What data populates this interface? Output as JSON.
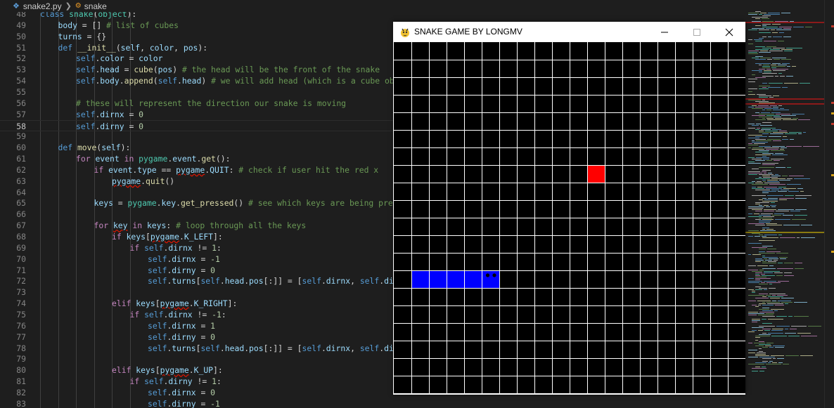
{
  "breadcrumb": {
    "file": "snake2.py",
    "symbol": "snake"
  },
  "editor": {
    "current_line": 58,
    "lines": [
      {
        "n": 48,
        "indent": 0,
        "tokens": [
          {
            "t": "class ",
            "c": "kw"
          },
          {
            "t": "snake",
            "c": "cls"
          },
          {
            "t": "(",
            "c": "txt"
          },
          {
            "t": "object",
            "c": "cls"
          },
          {
            "t": "):",
            "c": "txt"
          }
        ]
      },
      {
        "n": 49,
        "indent": 1,
        "tokens": [
          {
            "t": "body",
            "c": "var"
          },
          {
            "t": " = [] ",
            "c": "txt"
          },
          {
            "t": "# list of cubes",
            "c": "com"
          }
        ]
      },
      {
        "n": 50,
        "indent": 1,
        "tokens": [
          {
            "t": "turns",
            "c": "var"
          },
          {
            "t": " = {}",
            "c": "txt"
          }
        ]
      },
      {
        "n": 51,
        "indent": 1,
        "tokens": [
          {
            "t": "def ",
            "c": "kw"
          },
          {
            "t": "__init__",
            "c": "fn"
          },
          {
            "t": "(",
            "c": "txt"
          },
          {
            "t": "self",
            "c": "var"
          },
          {
            "t": ", ",
            "c": "txt"
          },
          {
            "t": "color",
            "c": "var"
          },
          {
            "t": ", ",
            "c": "txt"
          },
          {
            "t": "pos",
            "c": "var"
          },
          {
            "t": "):",
            "c": "txt"
          }
        ]
      },
      {
        "n": 52,
        "indent": 2,
        "tokens": [
          {
            "t": "self",
            "c": "self"
          },
          {
            "t": ".",
            "c": "txt"
          },
          {
            "t": "color",
            "c": "var"
          },
          {
            "t": " = ",
            "c": "txt"
          },
          {
            "t": "color",
            "c": "var"
          }
        ]
      },
      {
        "n": 53,
        "indent": 2,
        "tokens": [
          {
            "t": "self",
            "c": "self"
          },
          {
            "t": ".",
            "c": "txt"
          },
          {
            "t": "head",
            "c": "var"
          },
          {
            "t": " = ",
            "c": "txt"
          },
          {
            "t": "cube",
            "c": "fn"
          },
          {
            "t": "(",
            "c": "txt"
          },
          {
            "t": "pos",
            "c": "var"
          },
          {
            "t": ") ",
            "c": "txt"
          },
          {
            "t": "# the head will be the front of the snake",
            "c": "com"
          }
        ]
      },
      {
        "n": 54,
        "indent": 2,
        "tokens": [
          {
            "t": "self",
            "c": "self"
          },
          {
            "t": ".",
            "c": "txt"
          },
          {
            "t": "body",
            "c": "var"
          },
          {
            "t": ".",
            "c": "txt"
          },
          {
            "t": "append",
            "c": "fn"
          },
          {
            "t": "(",
            "c": "txt"
          },
          {
            "t": "self",
            "c": "self"
          },
          {
            "t": ".",
            "c": "txt"
          },
          {
            "t": "head",
            "c": "var"
          },
          {
            "t": ") ",
            "c": "txt"
          },
          {
            "t": "# we will add head (which is a cube object",
            "c": "com"
          }
        ]
      },
      {
        "n": 55,
        "indent": 2,
        "tokens": []
      },
      {
        "n": 56,
        "indent": 2,
        "tokens": [
          {
            "t": "# these will represent the direction our snake is moving",
            "c": "com"
          }
        ]
      },
      {
        "n": 57,
        "indent": 2,
        "tokens": [
          {
            "t": "self",
            "c": "self"
          },
          {
            "t": ".",
            "c": "txt"
          },
          {
            "t": "dirnx",
            "c": "var"
          },
          {
            "t": " = ",
            "c": "txt"
          },
          {
            "t": "0",
            "c": "num"
          }
        ]
      },
      {
        "n": 58,
        "indent": 2,
        "tokens": [
          {
            "t": "self",
            "c": "self"
          },
          {
            "t": ".",
            "c": "txt"
          },
          {
            "t": "dirny",
            "c": "var"
          },
          {
            "t": " = ",
            "c": "txt"
          },
          {
            "t": "0",
            "c": "num"
          }
        ]
      },
      {
        "n": 59,
        "indent": 1,
        "tokens": []
      },
      {
        "n": 60,
        "indent": 1,
        "tokens": [
          {
            "t": "def ",
            "c": "kw"
          },
          {
            "t": "move",
            "c": "fn"
          },
          {
            "t": "(",
            "c": "txt"
          },
          {
            "t": "self",
            "c": "var"
          },
          {
            "t": "):",
            "c": "txt"
          }
        ]
      },
      {
        "n": 61,
        "indent": 2,
        "tokens": [
          {
            "t": "for ",
            "c": "ctl"
          },
          {
            "t": "event",
            "c": "var"
          },
          {
            "t": " in ",
            "c": "ctl"
          },
          {
            "t": "pygame",
            "c": "cls"
          },
          {
            "t": ".",
            "c": "txt"
          },
          {
            "t": "event",
            "c": "var"
          },
          {
            "t": ".",
            "c": "txt"
          },
          {
            "t": "get",
            "c": "fn"
          },
          {
            "t": "():",
            "c": "txt"
          }
        ]
      },
      {
        "n": 62,
        "indent": 3,
        "tokens": [
          {
            "t": "if ",
            "c": "ctl"
          },
          {
            "t": "event",
            "c": "var"
          },
          {
            "t": ".",
            "c": "txt"
          },
          {
            "t": "type",
            "c": "var"
          },
          {
            "t": " == ",
            "c": "txt"
          },
          {
            "t": "pygame",
            "c": "err"
          },
          {
            "t": ".",
            "c": "txt"
          },
          {
            "t": "QUIT",
            "c": "var"
          },
          {
            "t": ": ",
            "c": "txt"
          },
          {
            "t": "# check if user hit the red x",
            "c": "com"
          }
        ]
      },
      {
        "n": 63,
        "indent": 4,
        "tokens": [
          {
            "t": "pygame",
            "c": "err"
          },
          {
            "t": ".",
            "c": "txt"
          },
          {
            "t": "quit",
            "c": "fn"
          },
          {
            "t": "()",
            "c": "txt"
          }
        ]
      },
      {
        "n": 64,
        "indent": 2,
        "tokens": []
      },
      {
        "n": 65,
        "indent": 3,
        "tokens": [
          {
            "t": "keys",
            "c": "var"
          },
          {
            "t": " = ",
            "c": "txt"
          },
          {
            "t": "pygame",
            "c": "cls"
          },
          {
            "t": ".",
            "c": "txt"
          },
          {
            "t": "key",
            "c": "var"
          },
          {
            "t": ".",
            "c": "txt"
          },
          {
            "t": "get_pressed",
            "c": "fn"
          },
          {
            "t": "() ",
            "c": "txt"
          },
          {
            "t": "# see which keys are being pressed",
            "c": "com"
          }
        ]
      },
      {
        "n": 66,
        "indent": 2,
        "tokens": []
      },
      {
        "n": 67,
        "indent": 3,
        "tokens": [
          {
            "t": "for ",
            "c": "ctl"
          },
          {
            "t": "key",
            "c": "err"
          },
          {
            "t": " in ",
            "c": "ctl"
          },
          {
            "t": "keys",
            "c": "var"
          },
          {
            "t": ": ",
            "c": "txt"
          },
          {
            "t": "# loop through all the keys",
            "c": "com"
          }
        ]
      },
      {
        "n": 68,
        "indent": 4,
        "tokens": [
          {
            "t": "if ",
            "c": "ctl"
          },
          {
            "t": "keys",
            "c": "var"
          },
          {
            "t": "[",
            "c": "txt"
          },
          {
            "t": "pygame",
            "c": "err"
          },
          {
            "t": ".",
            "c": "txt"
          },
          {
            "t": "K_LEFT",
            "c": "var"
          },
          {
            "t": "]:",
            "c": "txt"
          }
        ]
      },
      {
        "n": 69,
        "indent": 5,
        "tokens": [
          {
            "t": "if ",
            "c": "ctl"
          },
          {
            "t": "self",
            "c": "self"
          },
          {
            "t": ".",
            "c": "txt"
          },
          {
            "t": "dirnx",
            "c": "var"
          },
          {
            "t": " != ",
            "c": "txt"
          },
          {
            "t": "1",
            "c": "num"
          },
          {
            "t": ":",
            "c": "txt"
          }
        ]
      },
      {
        "n": 70,
        "indent": 6,
        "tokens": [
          {
            "t": "self",
            "c": "self"
          },
          {
            "t": ".",
            "c": "txt"
          },
          {
            "t": "dirnx",
            "c": "var"
          },
          {
            "t": " = ",
            "c": "txt"
          },
          {
            "t": "-1",
            "c": "num"
          }
        ]
      },
      {
        "n": 71,
        "indent": 6,
        "tokens": [
          {
            "t": "self",
            "c": "self"
          },
          {
            "t": ".",
            "c": "txt"
          },
          {
            "t": "dirny",
            "c": "var"
          },
          {
            "t": " = ",
            "c": "txt"
          },
          {
            "t": "0",
            "c": "num"
          }
        ]
      },
      {
        "n": 72,
        "indent": 6,
        "tokens": [
          {
            "t": "self",
            "c": "self"
          },
          {
            "t": ".",
            "c": "txt"
          },
          {
            "t": "turns",
            "c": "var"
          },
          {
            "t": "[",
            "c": "txt"
          },
          {
            "t": "self",
            "c": "self"
          },
          {
            "t": ".",
            "c": "txt"
          },
          {
            "t": "head",
            "c": "var"
          },
          {
            "t": ".",
            "c": "txt"
          },
          {
            "t": "pos",
            "c": "var"
          },
          {
            "t": "[:]] = [",
            "c": "txt"
          },
          {
            "t": "self",
            "c": "self"
          },
          {
            "t": ".",
            "c": "txt"
          },
          {
            "t": "dirnx",
            "c": "var"
          },
          {
            "t": ", ",
            "c": "txt"
          },
          {
            "t": "self",
            "c": "self"
          },
          {
            "t": ".",
            "c": "txt"
          },
          {
            "t": "dirny",
            "c": "var"
          }
        ]
      },
      {
        "n": 73,
        "indent": 4,
        "tokens": []
      },
      {
        "n": 74,
        "indent": 4,
        "tokens": [
          {
            "t": "elif ",
            "c": "ctl"
          },
          {
            "t": "keys",
            "c": "var"
          },
          {
            "t": "[",
            "c": "txt"
          },
          {
            "t": "pygame",
            "c": "err"
          },
          {
            "t": ".",
            "c": "txt"
          },
          {
            "t": "K_RIGHT",
            "c": "var"
          },
          {
            "t": "]:",
            "c": "txt"
          }
        ]
      },
      {
        "n": 75,
        "indent": 5,
        "tokens": [
          {
            "t": "if ",
            "c": "ctl"
          },
          {
            "t": "self",
            "c": "self"
          },
          {
            "t": ".",
            "c": "txt"
          },
          {
            "t": "dirnx",
            "c": "var"
          },
          {
            "t": " != ",
            "c": "txt"
          },
          {
            "t": "-1",
            "c": "num"
          },
          {
            "t": ":",
            "c": "txt"
          }
        ]
      },
      {
        "n": 76,
        "indent": 6,
        "tokens": [
          {
            "t": "self",
            "c": "self"
          },
          {
            "t": ".",
            "c": "txt"
          },
          {
            "t": "dirnx",
            "c": "var"
          },
          {
            "t": " = ",
            "c": "txt"
          },
          {
            "t": "1",
            "c": "num"
          }
        ]
      },
      {
        "n": 77,
        "indent": 6,
        "tokens": [
          {
            "t": "self",
            "c": "self"
          },
          {
            "t": ".",
            "c": "txt"
          },
          {
            "t": "dirny",
            "c": "var"
          },
          {
            "t": " = ",
            "c": "txt"
          },
          {
            "t": "0",
            "c": "num"
          }
        ]
      },
      {
        "n": 78,
        "indent": 6,
        "tokens": [
          {
            "t": "self",
            "c": "self"
          },
          {
            "t": ".",
            "c": "txt"
          },
          {
            "t": "turns",
            "c": "var"
          },
          {
            "t": "[",
            "c": "txt"
          },
          {
            "t": "self",
            "c": "self"
          },
          {
            "t": ".",
            "c": "txt"
          },
          {
            "t": "head",
            "c": "var"
          },
          {
            "t": ".",
            "c": "txt"
          },
          {
            "t": "pos",
            "c": "var"
          },
          {
            "t": "[:]] = [",
            "c": "txt"
          },
          {
            "t": "self",
            "c": "self"
          },
          {
            "t": ".",
            "c": "txt"
          },
          {
            "t": "dirnx",
            "c": "var"
          },
          {
            "t": ", ",
            "c": "txt"
          },
          {
            "t": "self",
            "c": "self"
          },
          {
            "t": ".",
            "c": "txt"
          },
          {
            "t": "dirny",
            "c": "var"
          }
        ]
      },
      {
        "n": 79,
        "indent": 4,
        "tokens": []
      },
      {
        "n": 80,
        "indent": 4,
        "tokens": [
          {
            "t": "elif ",
            "c": "ctl"
          },
          {
            "t": "keys",
            "c": "var"
          },
          {
            "t": "[",
            "c": "txt"
          },
          {
            "t": "pygame",
            "c": "err"
          },
          {
            "t": ".",
            "c": "txt"
          },
          {
            "t": "K_UP",
            "c": "var"
          },
          {
            "t": "]:",
            "c": "txt"
          }
        ]
      },
      {
        "n": 81,
        "indent": 5,
        "tokens": [
          {
            "t": "if ",
            "c": "ctl"
          },
          {
            "t": "self",
            "c": "self"
          },
          {
            "t": ".",
            "c": "txt"
          },
          {
            "t": "dirny",
            "c": "var"
          },
          {
            "t": " != ",
            "c": "txt"
          },
          {
            "t": "1",
            "c": "num"
          },
          {
            "t": ":",
            "c": "txt"
          }
        ]
      },
      {
        "n": 82,
        "indent": 6,
        "tokens": [
          {
            "t": "self",
            "c": "self"
          },
          {
            "t": ".",
            "c": "txt"
          },
          {
            "t": "dirnx",
            "c": "var"
          },
          {
            "t": " = ",
            "c": "txt"
          },
          {
            "t": "0",
            "c": "num"
          }
        ]
      },
      {
        "n": 83,
        "indent": 6,
        "tokens": [
          {
            "t": "self",
            "c": "self"
          },
          {
            "t": ".",
            "c": "txt"
          },
          {
            "t": "dirny",
            "c": "var"
          },
          {
            "t": " = ",
            "c": "txt"
          },
          {
            "t": "-1",
            "c": "num"
          }
        ]
      }
    ]
  },
  "game_window": {
    "title": "SNAKE GAME BY LONGMV",
    "min_label": "—",
    "max_label": "☐",
    "close_label": "✕",
    "grid_rows": 20,
    "grid_cols": 20,
    "background_color": "#000000",
    "grid_color": "#ffffff",
    "snack": {
      "row": 7,
      "col": 11,
      "color": "#ff0000"
    },
    "snake": {
      "color": "#0000ff",
      "head": {
        "row": 13,
        "col": 5
      },
      "body": [
        {
          "row": 13,
          "col": 1
        },
        {
          "row": 13,
          "col": 2
        },
        {
          "row": 13,
          "col": 3
        },
        {
          "row": 13,
          "col": 4
        },
        {
          "row": 13,
          "col": 5
        }
      ]
    }
  },
  "icons": {
    "file": "python-file-icon",
    "symbol": "class-symbol-icon",
    "app": "pygame-snake-icon"
  }
}
